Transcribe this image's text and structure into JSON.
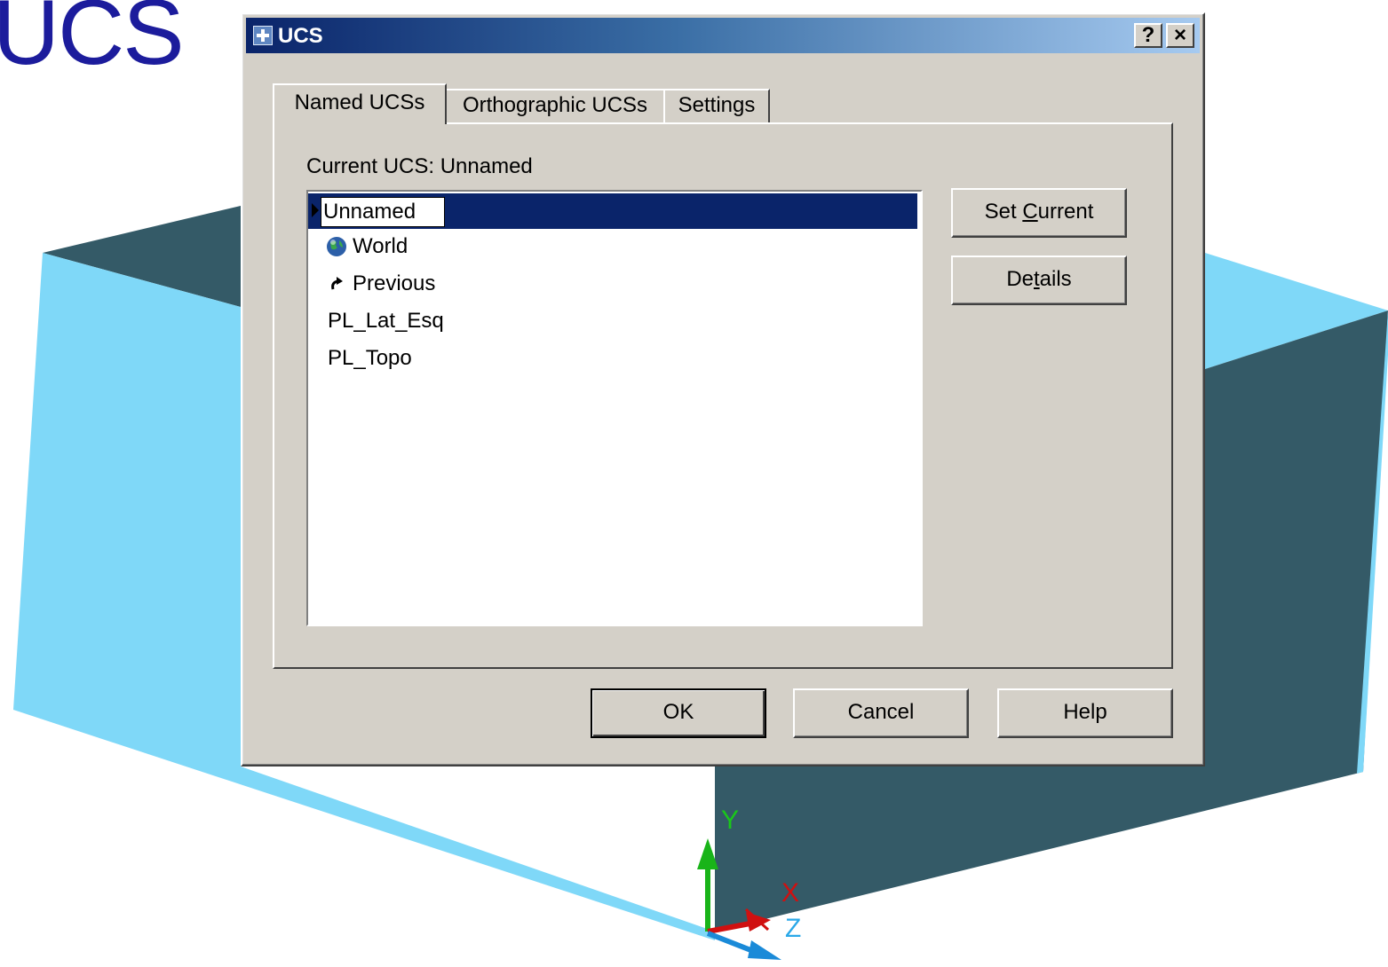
{
  "slide": {
    "title": "UCS"
  },
  "dialog": {
    "title": "UCS",
    "help_button": "?",
    "close_button": "×",
    "tabs": [
      {
        "label": "Named UCSs",
        "active": true
      },
      {
        "label": "Orthographic UCSs",
        "active": false
      },
      {
        "label": "Settings",
        "active": false
      }
    ],
    "current_ucs_label": "Current UCS:  Unnamed",
    "list_items": [
      {
        "label": "Unnamed",
        "icon": "none",
        "selected": true,
        "editing": true
      },
      {
        "label": "World",
        "icon": "globe-icon",
        "selected": false
      },
      {
        "label": "Previous",
        "icon": "undo-arrow-icon",
        "selected": false
      },
      {
        "label": "PL_Lat_Esq",
        "icon": "none",
        "selected": false
      },
      {
        "label": "PL_Topo",
        "icon": "none",
        "selected": false
      }
    ],
    "buttons": {
      "set_current_prefix": "Set ",
      "set_current_underline": "C",
      "set_current_suffix": "urrent",
      "details_prefix": "De",
      "details_underline": "t",
      "details_suffix": "ails",
      "ok": "OK",
      "cancel": "Cancel",
      "help": "Help"
    }
  },
  "axes": {
    "x": "X",
    "y": "Y",
    "z": "Z"
  },
  "colors": {
    "light_face": "#7fd8f8",
    "dark_face": "#345a67",
    "title_text": "#1c1c9c",
    "selection": "#0a246a",
    "dialog_face": "#d4d0c8"
  }
}
